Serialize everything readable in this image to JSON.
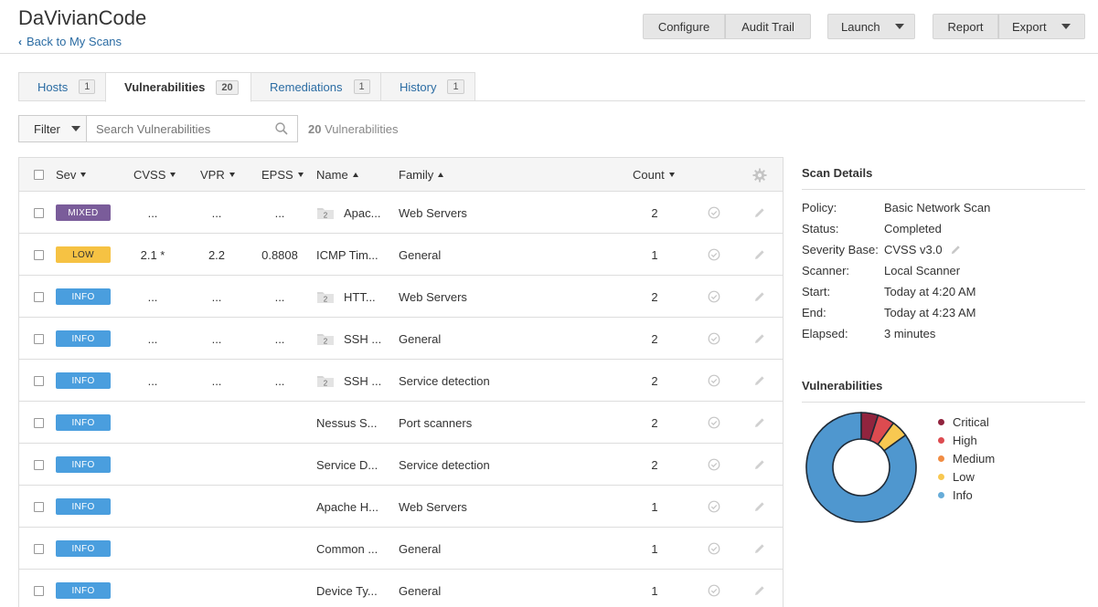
{
  "header": {
    "title": "DaVivianCode",
    "back_label": "Back to My Scans",
    "buttons": {
      "configure": "Configure",
      "audit_trail": "Audit Trail",
      "launch": "Launch",
      "report": "Report",
      "export": "Export"
    }
  },
  "tabs": [
    {
      "label": "Hosts",
      "count": "1"
    },
    {
      "label": "Vulnerabilities",
      "count": "20",
      "active": true
    },
    {
      "label": "Remediations",
      "count": "1"
    },
    {
      "label": "History",
      "count": "1"
    }
  ],
  "filter": {
    "label": "Filter",
    "search_placeholder": "Search Vulnerabilities",
    "count_num": "20",
    "count_label": " Vulnerabilities"
  },
  "table": {
    "columns": {
      "sev": "Sev",
      "cvss": "CVSS",
      "vpr": "VPR",
      "epss": "EPSS",
      "name": "Name",
      "family": "Family",
      "count": "Count"
    },
    "rows": [
      {
        "sev": "MIXED",
        "sev_class": "mixed",
        "cvss": "...",
        "vpr": "...",
        "epss": "...",
        "group": "2",
        "name": "Apac...",
        "family": "Web Servers",
        "count": "2"
      },
      {
        "sev": "LOW",
        "sev_class": "low",
        "cvss": "2.1 *",
        "vpr": "2.2",
        "epss": "0.8808",
        "group": "",
        "name": "ICMP Tim...",
        "family": "General",
        "count": "1"
      },
      {
        "sev": "INFO",
        "sev_class": "info",
        "cvss": "...",
        "vpr": "...",
        "epss": "...",
        "group": "2",
        "name": "HTT...",
        "family": "Web Servers",
        "count": "2"
      },
      {
        "sev": "INFO",
        "sev_class": "info",
        "cvss": "...",
        "vpr": "...",
        "epss": "...",
        "group": "2",
        "name": "SSH ...",
        "family": "General",
        "count": "2"
      },
      {
        "sev": "INFO",
        "sev_class": "info",
        "cvss": "...",
        "vpr": "...",
        "epss": "...",
        "group": "2",
        "name": "SSH ...",
        "family": "Service detection",
        "count": "2"
      },
      {
        "sev": "INFO",
        "sev_class": "info",
        "cvss": "",
        "vpr": "",
        "epss": "",
        "group": "",
        "name": "Nessus S...",
        "family": "Port scanners",
        "count": "2"
      },
      {
        "sev": "INFO",
        "sev_class": "info",
        "cvss": "",
        "vpr": "",
        "epss": "",
        "group": "",
        "name": "Service D...",
        "family": "Service detection",
        "count": "2"
      },
      {
        "sev": "INFO",
        "sev_class": "info",
        "cvss": "",
        "vpr": "",
        "epss": "",
        "group": "",
        "name": "Apache H...",
        "family": "Web Servers",
        "count": "1"
      },
      {
        "sev": "INFO",
        "sev_class": "info",
        "cvss": "",
        "vpr": "",
        "epss": "",
        "group": "",
        "name": "Common ...",
        "family": "General",
        "count": "1"
      },
      {
        "sev": "INFO",
        "sev_class": "info",
        "cvss": "",
        "vpr": "",
        "epss": "",
        "group": "",
        "name": "Device Ty...",
        "family": "General",
        "count": "1"
      }
    ]
  },
  "scan_details": {
    "title": "Scan Details",
    "items": [
      {
        "key": "Policy:",
        "value": "Basic Network Scan"
      },
      {
        "key": "Status:",
        "value": "Completed"
      },
      {
        "key": "Severity Base:",
        "value": "CVSS v3.0",
        "editable": true
      },
      {
        "key": "Scanner:",
        "value": "Local Scanner"
      },
      {
        "key": "Start:",
        "value": "Today at 4:20 AM"
      },
      {
        "key": "End:",
        "value": "Today at 4:23 AM"
      },
      {
        "key": "Elapsed:",
        "value": "3 minutes"
      }
    ]
  },
  "vulnerabilities_panel": {
    "title": "Vulnerabilities",
    "legend": [
      {
        "label": "Critical",
        "color": "#91243e"
      },
      {
        "label": "High",
        "color": "#dd4b50"
      },
      {
        "label": "Medium",
        "color": "#f18c43"
      },
      {
        "label": "Low",
        "color": "#f8c851"
      },
      {
        "label": "Info",
        "color": "#67acd8"
      }
    ]
  },
  "chart_data": {
    "type": "pie",
    "categories": [
      "Critical",
      "High",
      "Medium",
      "Low",
      "Info"
    ],
    "values": [
      1,
      1,
      0,
      1,
      17
    ],
    "colors": [
      "#91243e",
      "#dd4b50",
      "#f18c43",
      "#f8c851",
      "#4f97cf"
    ],
    "donut": true,
    "legend_position": "right"
  }
}
